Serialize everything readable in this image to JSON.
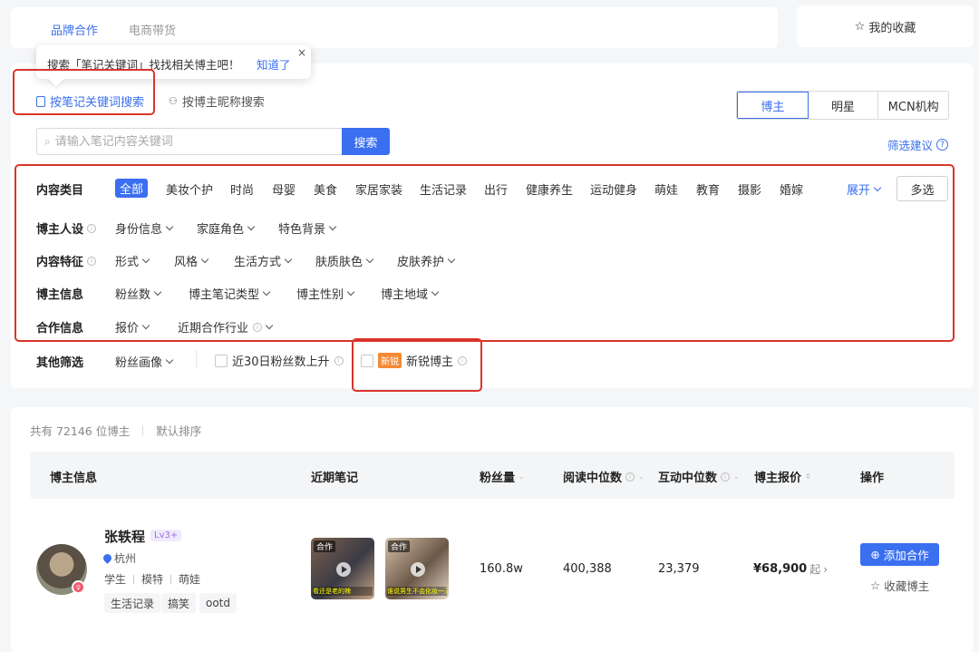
{
  "top_tabs": [
    {
      "label": "品牌合作"
    },
    {
      "label": "电商带货"
    }
  ],
  "favorites_label": "我的收藏",
  "tooltip": {
    "text": "搜索「笔记关键词」找找相关博主吧！",
    "ok": "知道了",
    "close": "×"
  },
  "search_modes": {
    "by_keyword": "按笔记关键词搜索",
    "by_nickname": "按博主昵称搜索"
  },
  "segments": [
    "博主",
    "明星",
    "MCN机构"
  ],
  "search": {
    "placeholder": "请输入笔记内容关键词",
    "button": "搜索",
    "suggest": "筛选建议"
  },
  "filters": {
    "content_category": {
      "label": "内容类目",
      "items": [
        "全部",
        "美妆个护",
        "时尚",
        "母婴",
        "美食",
        "家居家装",
        "生活记录",
        "出行",
        "健康养生",
        "运动健身",
        "萌娃",
        "教育",
        "摄影",
        "婚嫁"
      ],
      "expand": "展开",
      "multi": "多选"
    },
    "persona": {
      "label": "博主人设",
      "dropdowns": [
        "身份信息",
        "家庭角色",
        "特色背景"
      ]
    },
    "content_features": {
      "label": "内容特征",
      "dropdowns": [
        "形式",
        "风格",
        "生活方式",
        "肤质肤色",
        "皮肤养护"
      ]
    },
    "blogger_info": {
      "label": "博主信息",
      "dropdowns": [
        "粉丝数",
        "博主笔记类型",
        "博主性别",
        "博主地域"
      ]
    },
    "cooperation": {
      "label": "合作信息",
      "dropdowns": [
        "报价",
        "近期合作行业"
      ]
    },
    "other": {
      "label": "其他筛选",
      "fan_profile": "粉丝画像",
      "fan_rise": "近30日粉丝数上升",
      "new_badge": "新锐",
      "new_blogger": "新锐博主"
    }
  },
  "results": {
    "count_text": "共有 72146 位博主",
    "sort_text": "默认排序",
    "columns": [
      "博主信息",
      "近期笔记",
      "粉丝量",
      "阅读中位数",
      "互动中位数",
      "博主报价",
      "操作"
    ],
    "rows": [
      {
        "name": "张轶程",
        "level": "Lv3+",
        "location": "杭州",
        "identity_tags": [
          "学生",
          "模特",
          "萌娃"
        ],
        "content_tags": [
          "生活记录",
          "搞笑",
          "ootd"
        ],
        "notes": [
          {
            "label": "合作",
            "caption": "看还是老的辣"
          },
          {
            "label": "合作",
            "caption": "谁说男生不会化妆一天"
          }
        ],
        "fans": "160.8w",
        "read_median": "400,388",
        "interact_median": "23,379",
        "price": "¥68,900",
        "price_suffix": "起",
        "add_label": "添加合作",
        "collect_label": "收藏博主"
      }
    ]
  },
  "colors": {
    "accent": "#3a6ff0",
    "highlight_box": "#d9342b",
    "new_badge": "#f58a35"
  }
}
